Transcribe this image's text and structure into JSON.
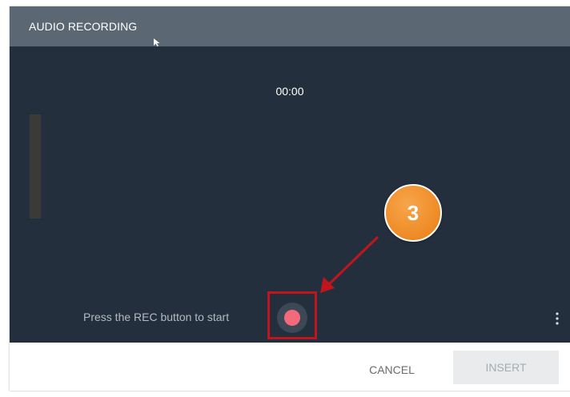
{
  "dialog": {
    "title": "AUDIO RECORDING",
    "timer": "00:00",
    "prompt": "Press the REC button to start",
    "buttons": {
      "cancel": "CANCEL",
      "insert": "INSERT"
    }
  },
  "annotation": {
    "step_number": "3"
  },
  "colors": {
    "title_bar": "#5b6874",
    "stage_background": "#232f3d",
    "record_dot": "#f36b7a",
    "annotation_red": "#c0151c",
    "badge_orange": "#ee8a24"
  },
  "icons": {
    "record": "record-icon",
    "more": "vertical-ellipsis-icon",
    "cursor": "mouse-pointer-icon"
  }
}
